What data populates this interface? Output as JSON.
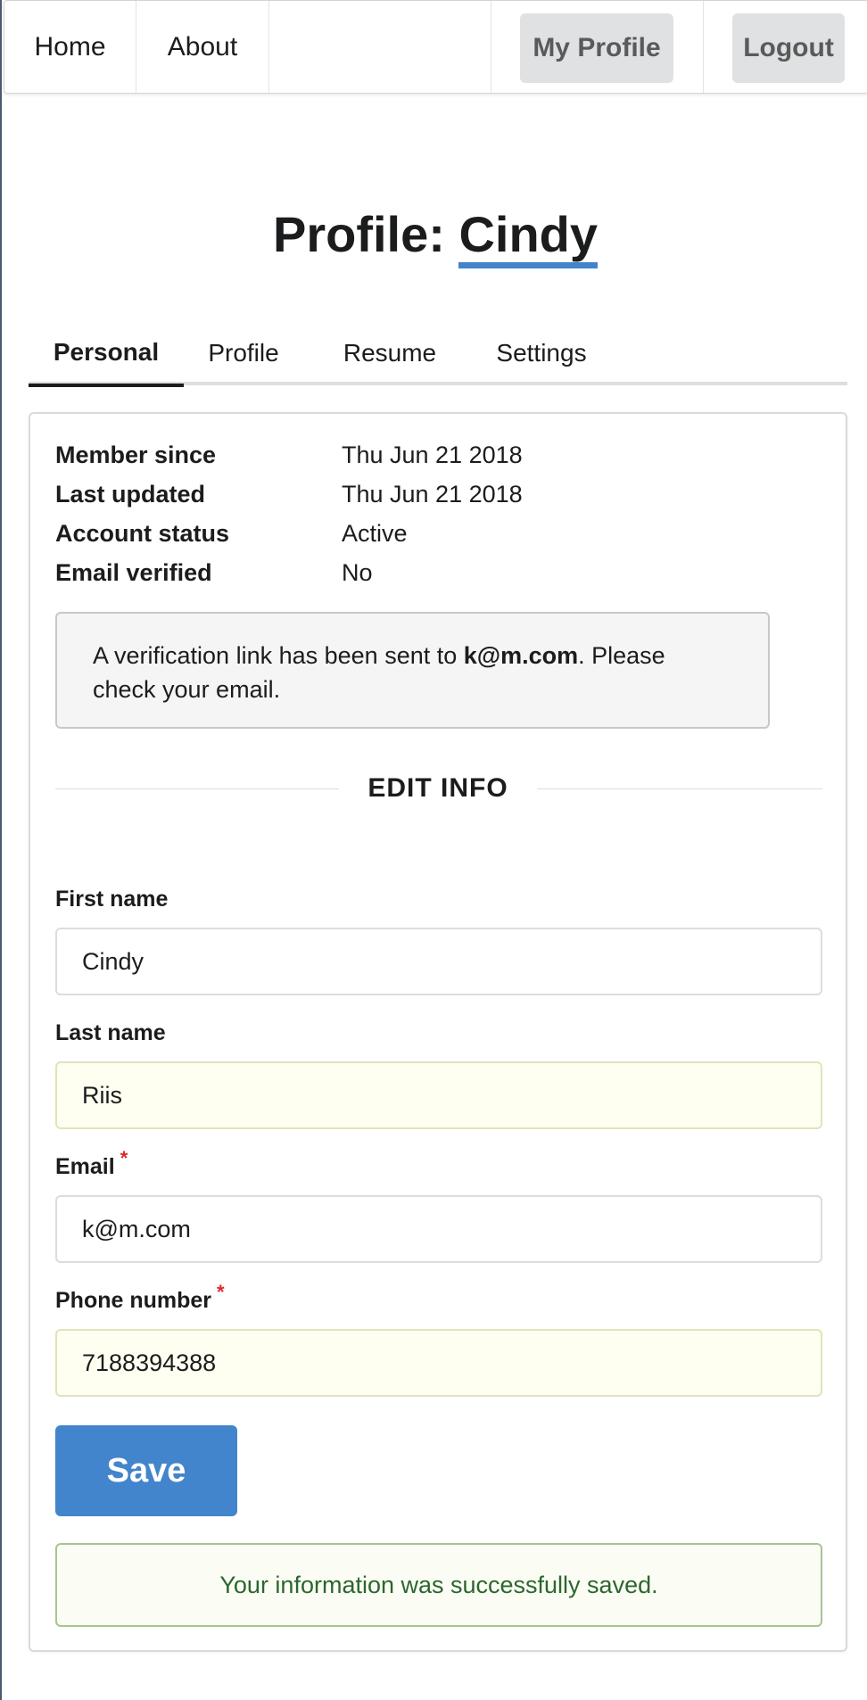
{
  "nav": {
    "home": "Home",
    "about": "About",
    "my_profile": "My Profile",
    "logout": "Logout"
  },
  "title": {
    "prefix": "Profile:",
    "name": "Cindy"
  },
  "tabs": [
    {
      "label": "Personal",
      "active": true
    },
    {
      "label": "Profile",
      "active": false
    },
    {
      "label": "Resume",
      "active": false
    },
    {
      "label": "Settings",
      "active": false
    }
  ],
  "info": {
    "rows": [
      {
        "label": "Member since",
        "value": "Thu Jun 21 2018"
      },
      {
        "label": "Last updated",
        "value": "Thu Jun 21 2018"
      },
      {
        "label": "Account status",
        "value": "Active"
      },
      {
        "label": "Email verified",
        "value": "No"
      }
    ]
  },
  "notice": {
    "text_before": "A verification link has been sent to ",
    "email": "k@m.com",
    "text_after": ". Please check your email."
  },
  "edit_header": "EDIT INFO",
  "form": {
    "first_name": {
      "label": "First name",
      "value": "Cindy"
    },
    "last_name": {
      "label": "Last name",
      "value": "Riis"
    },
    "email": {
      "label": "Email",
      "value": "k@m.com",
      "required_mark": "*"
    },
    "phone": {
      "label": "Phone number",
      "value": "7188394388",
      "required_mark": "*"
    },
    "save_label": "Save"
  },
  "success_message": "Your information was successfully saved.",
  "colors": {
    "accent": "#4283c9",
    "save_button": "#4385cc",
    "required": "#db2828",
    "success_text": "#2c662d"
  }
}
